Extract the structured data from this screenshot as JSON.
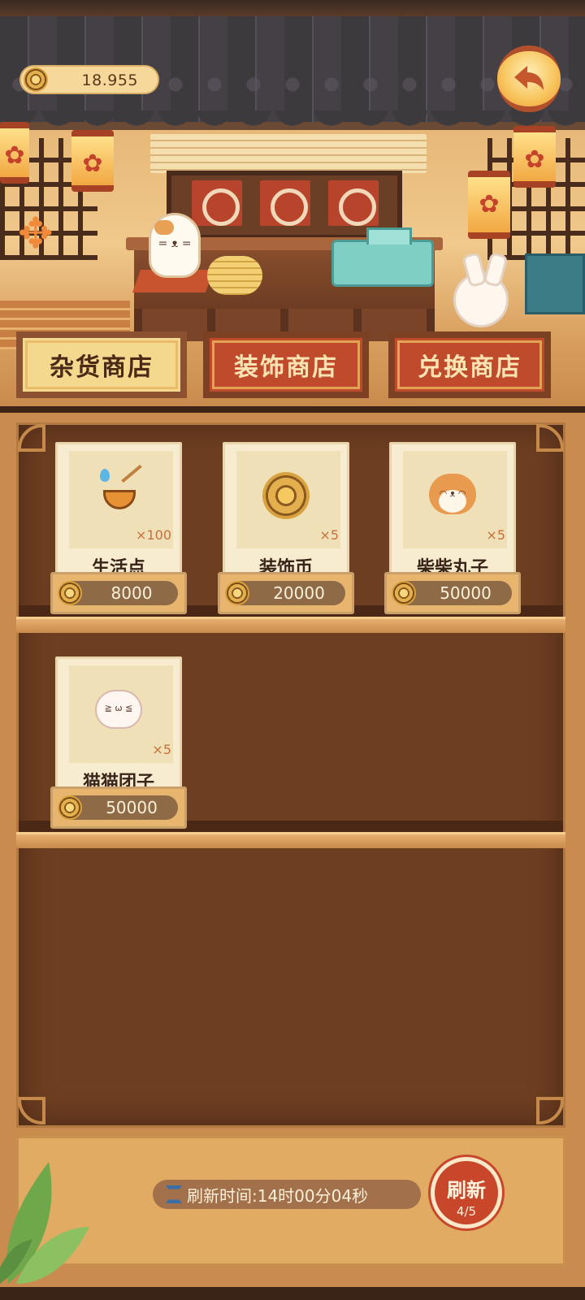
{
  "wallet": {
    "coins": "18.955"
  },
  "tabs": [
    {
      "label": "杂货商店",
      "active": true
    },
    {
      "label": "装饰商店",
      "active": false
    },
    {
      "label": "兑换商店",
      "active": false
    }
  ],
  "items": [
    {
      "name": "生活点",
      "qty": "×100",
      "price": "8000",
      "icon": "noodle-bowl-icon"
    },
    {
      "name": "装饰币",
      "qty": "×5",
      "price": "20000",
      "icon": "decor-coin-icon"
    },
    {
      "name": "柴柴丸子",
      "qty": "×5",
      "price": "50000",
      "icon": "shiba-dumpling-icon"
    },
    {
      "name": "猫猫团子",
      "qty": "×5",
      "price": "50000",
      "icon": "cat-dumpling-icon"
    }
  ],
  "footer": {
    "refresh_time": "刷新时间:14时00分04秒",
    "refresh_label": "刷新",
    "refresh_count": "4/5"
  },
  "colors": {
    "accent": "#c8472b",
    "wood": "#6e3e21",
    "paper": "#f7ecd0"
  }
}
